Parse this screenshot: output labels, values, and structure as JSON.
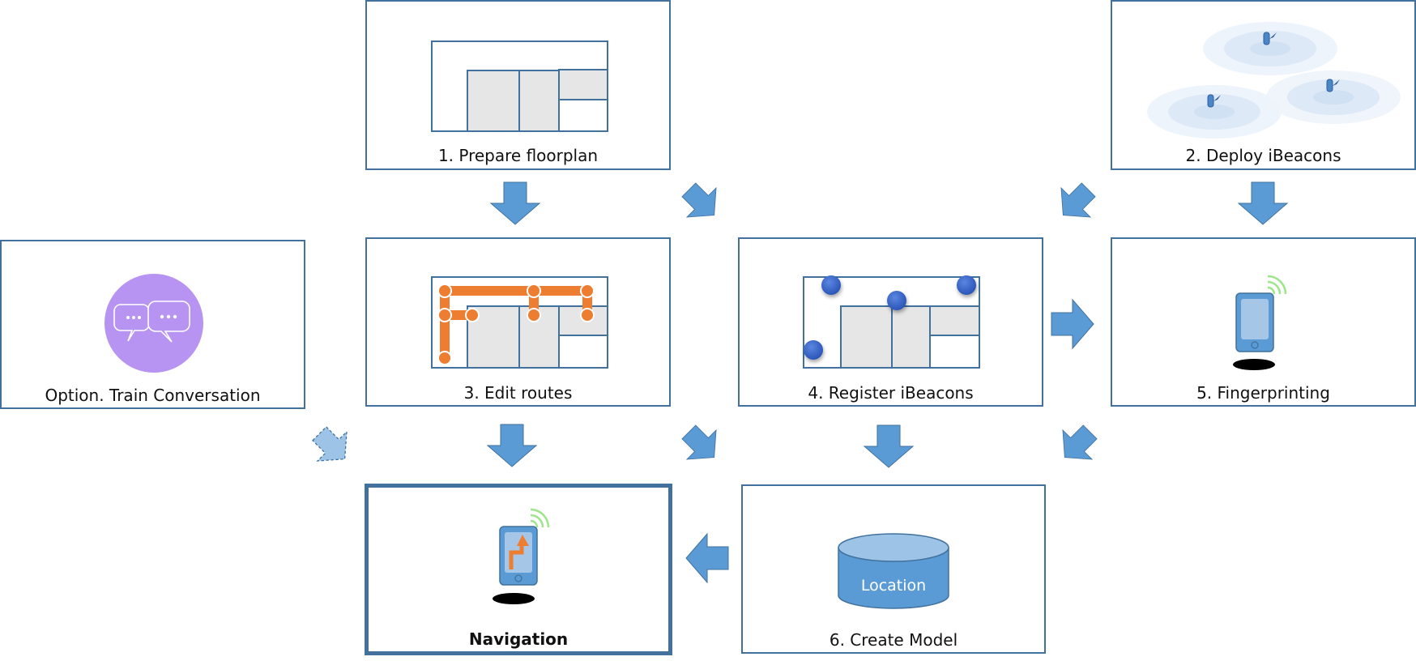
{
  "steps": {
    "prepare_floorplan": {
      "label": "1. Prepare floorplan"
    },
    "deploy_ibeacons": {
      "label": "2. Deploy iBeacons"
    },
    "edit_routes": {
      "label": "3. Edit routes"
    },
    "register_ibeacons": {
      "label": "4. Register iBeacons"
    },
    "fingerprinting": {
      "label": "5. Fingerprinting"
    },
    "create_model": {
      "label": "6. Create Model",
      "database_label": "Location"
    },
    "navigation": {
      "label": "Navigation"
    },
    "option": {
      "label": "Option. Train Conversation"
    }
  },
  "colors": {
    "border": "#41719c",
    "arrow_fill": "#5b9bd5",
    "arrow_optional_fill": "#9dc3e6",
    "route": "#ed7d31",
    "room_fill": "#e6e6e6",
    "beacon_dot": "#3563c9",
    "chat_circle": "#b793f2",
    "wifi": "#9fe58c"
  },
  "icons": [
    "floorplan-icon",
    "beacon-icon",
    "route-map-icon",
    "beacon-map-icon",
    "phone-wifi-icon",
    "database-icon",
    "phone-navigation-icon",
    "chat-bubbles-icon"
  ]
}
